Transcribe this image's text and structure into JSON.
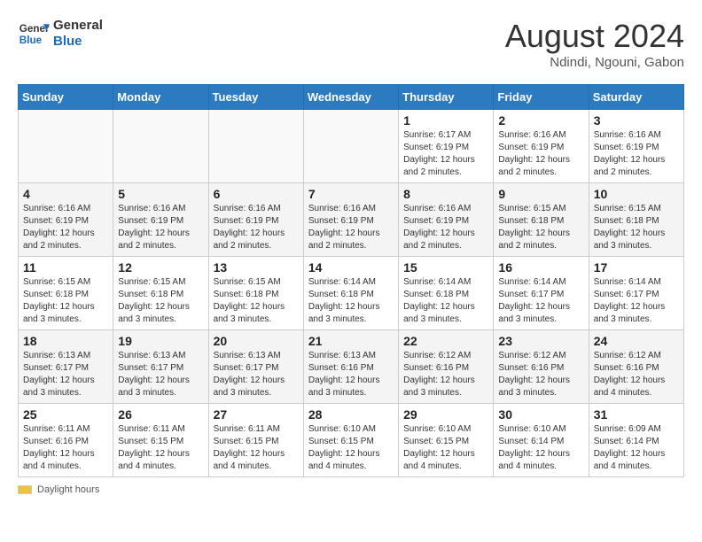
{
  "header": {
    "logo_line1": "General",
    "logo_line2": "Blue",
    "month_year": "August 2024",
    "location": "Ndindi, Ngouni, Gabon"
  },
  "days_of_week": [
    "Sunday",
    "Monday",
    "Tuesday",
    "Wednesday",
    "Thursday",
    "Friday",
    "Saturday"
  ],
  "weeks": [
    [
      {
        "day": "",
        "info": ""
      },
      {
        "day": "",
        "info": ""
      },
      {
        "day": "",
        "info": ""
      },
      {
        "day": "",
        "info": ""
      },
      {
        "day": "1",
        "info": "Sunrise: 6:17 AM\nSunset: 6:19 PM\nDaylight: 12 hours and 2 minutes."
      },
      {
        "day": "2",
        "info": "Sunrise: 6:16 AM\nSunset: 6:19 PM\nDaylight: 12 hours and 2 minutes."
      },
      {
        "day": "3",
        "info": "Sunrise: 6:16 AM\nSunset: 6:19 PM\nDaylight: 12 hours and 2 minutes."
      }
    ],
    [
      {
        "day": "4",
        "info": "Sunrise: 6:16 AM\nSunset: 6:19 PM\nDaylight: 12 hours and 2 minutes."
      },
      {
        "day": "5",
        "info": "Sunrise: 6:16 AM\nSunset: 6:19 PM\nDaylight: 12 hours and 2 minutes."
      },
      {
        "day": "6",
        "info": "Sunrise: 6:16 AM\nSunset: 6:19 PM\nDaylight: 12 hours and 2 minutes."
      },
      {
        "day": "7",
        "info": "Sunrise: 6:16 AM\nSunset: 6:19 PM\nDaylight: 12 hours and 2 minutes."
      },
      {
        "day": "8",
        "info": "Sunrise: 6:16 AM\nSunset: 6:19 PM\nDaylight: 12 hours and 2 minutes."
      },
      {
        "day": "9",
        "info": "Sunrise: 6:15 AM\nSunset: 6:18 PM\nDaylight: 12 hours and 2 minutes."
      },
      {
        "day": "10",
        "info": "Sunrise: 6:15 AM\nSunset: 6:18 PM\nDaylight: 12 hours and 3 minutes."
      }
    ],
    [
      {
        "day": "11",
        "info": "Sunrise: 6:15 AM\nSunset: 6:18 PM\nDaylight: 12 hours and 3 minutes."
      },
      {
        "day": "12",
        "info": "Sunrise: 6:15 AM\nSunset: 6:18 PM\nDaylight: 12 hours and 3 minutes."
      },
      {
        "day": "13",
        "info": "Sunrise: 6:15 AM\nSunset: 6:18 PM\nDaylight: 12 hours and 3 minutes."
      },
      {
        "day": "14",
        "info": "Sunrise: 6:14 AM\nSunset: 6:18 PM\nDaylight: 12 hours and 3 minutes."
      },
      {
        "day": "15",
        "info": "Sunrise: 6:14 AM\nSunset: 6:18 PM\nDaylight: 12 hours and 3 minutes."
      },
      {
        "day": "16",
        "info": "Sunrise: 6:14 AM\nSunset: 6:17 PM\nDaylight: 12 hours and 3 minutes."
      },
      {
        "day": "17",
        "info": "Sunrise: 6:14 AM\nSunset: 6:17 PM\nDaylight: 12 hours and 3 minutes."
      }
    ],
    [
      {
        "day": "18",
        "info": "Sunrise: 6:13 AM\nSunset: 6:17 PM\nDaylight: 12 hours and 3 minutes."
      },
      {
        "day": "19",
        "info": "Sunrise: 6:13 AM\nSunset: 6:17 PM\nDaylight: 12 hours and 3 minutes."
      },
      {
        "day": "20",
        "info": "Sunrise: 6:13 AM\nSunset: 6:17 PM\nDaylight: 12 hours and 3 minutes."
      },
      {
        "day": "21",
        "info": "Sunrise: 6:13 AM\nSunset: 6:16 PM\nDaylight: 12 hours and 3 minutes."
      },
      {
        "day": "22",
        "info": "Sunrise: 6:12 AM\nSunset: 6:16 PM\nDaylight: 12 hours and 3 minutes."
      },
      {
        "day": "23",
        "info": "Sunrise: 6:12 AM\nSunset: 6:16 PM\nDaylight: 12 hours and 3 minutes."
      },
      {
        "day": "24",
        "info": "Sunrise: 6:12 AM\nSunset: 6:16 PM\nDaylight: 12 hours and 4 minutes."
      }
    ],
    [
      {
        "day": "25",
        "info": "Sunrise: 6:11 AM\nSunset: 6:16 PM\nDaylight: 12 hours and 4 minutes."
      },
      {
        "day": "26",
        "info": "Sunrise: 6:11 AM\nSunset: 6:15 PM\nDaylight: 12 hours and 4 minutes."
      },
      {
        "day": "27",
        "info": "Sunrise: 6:11 AM\nSunset: 6:15 PM\nDaylight: 12 hours and 4 minutes."
      },
      {
        "day": "28",
        "info": "Sunrise: 6:10 AM\nSunset: 6:15 PM\nDaylight: 12 hours and 4 minutes."
      },
      {
        "day": "29",
        "info": "Sunrise: 6:10 AM\nSunset: 6:15 PM\nDaylight: 12 hours and 4 minutes."
      },
      {
        "day": "30",
        "info": "Sunrise: 6:10 AM\nSunset: 6:14 PM\nDaylight: 12 hours and 4 minutes."
      },
      {
        "day": "31",
        "info": "Sunrise: 6:09 AM\nSunset: 6:14 PM\nDaylight: 12 hours and 4 minutes."
      }
    ]
  ],
  "legend": {
    "daylight_label": "Daylight hours"
  }
}
